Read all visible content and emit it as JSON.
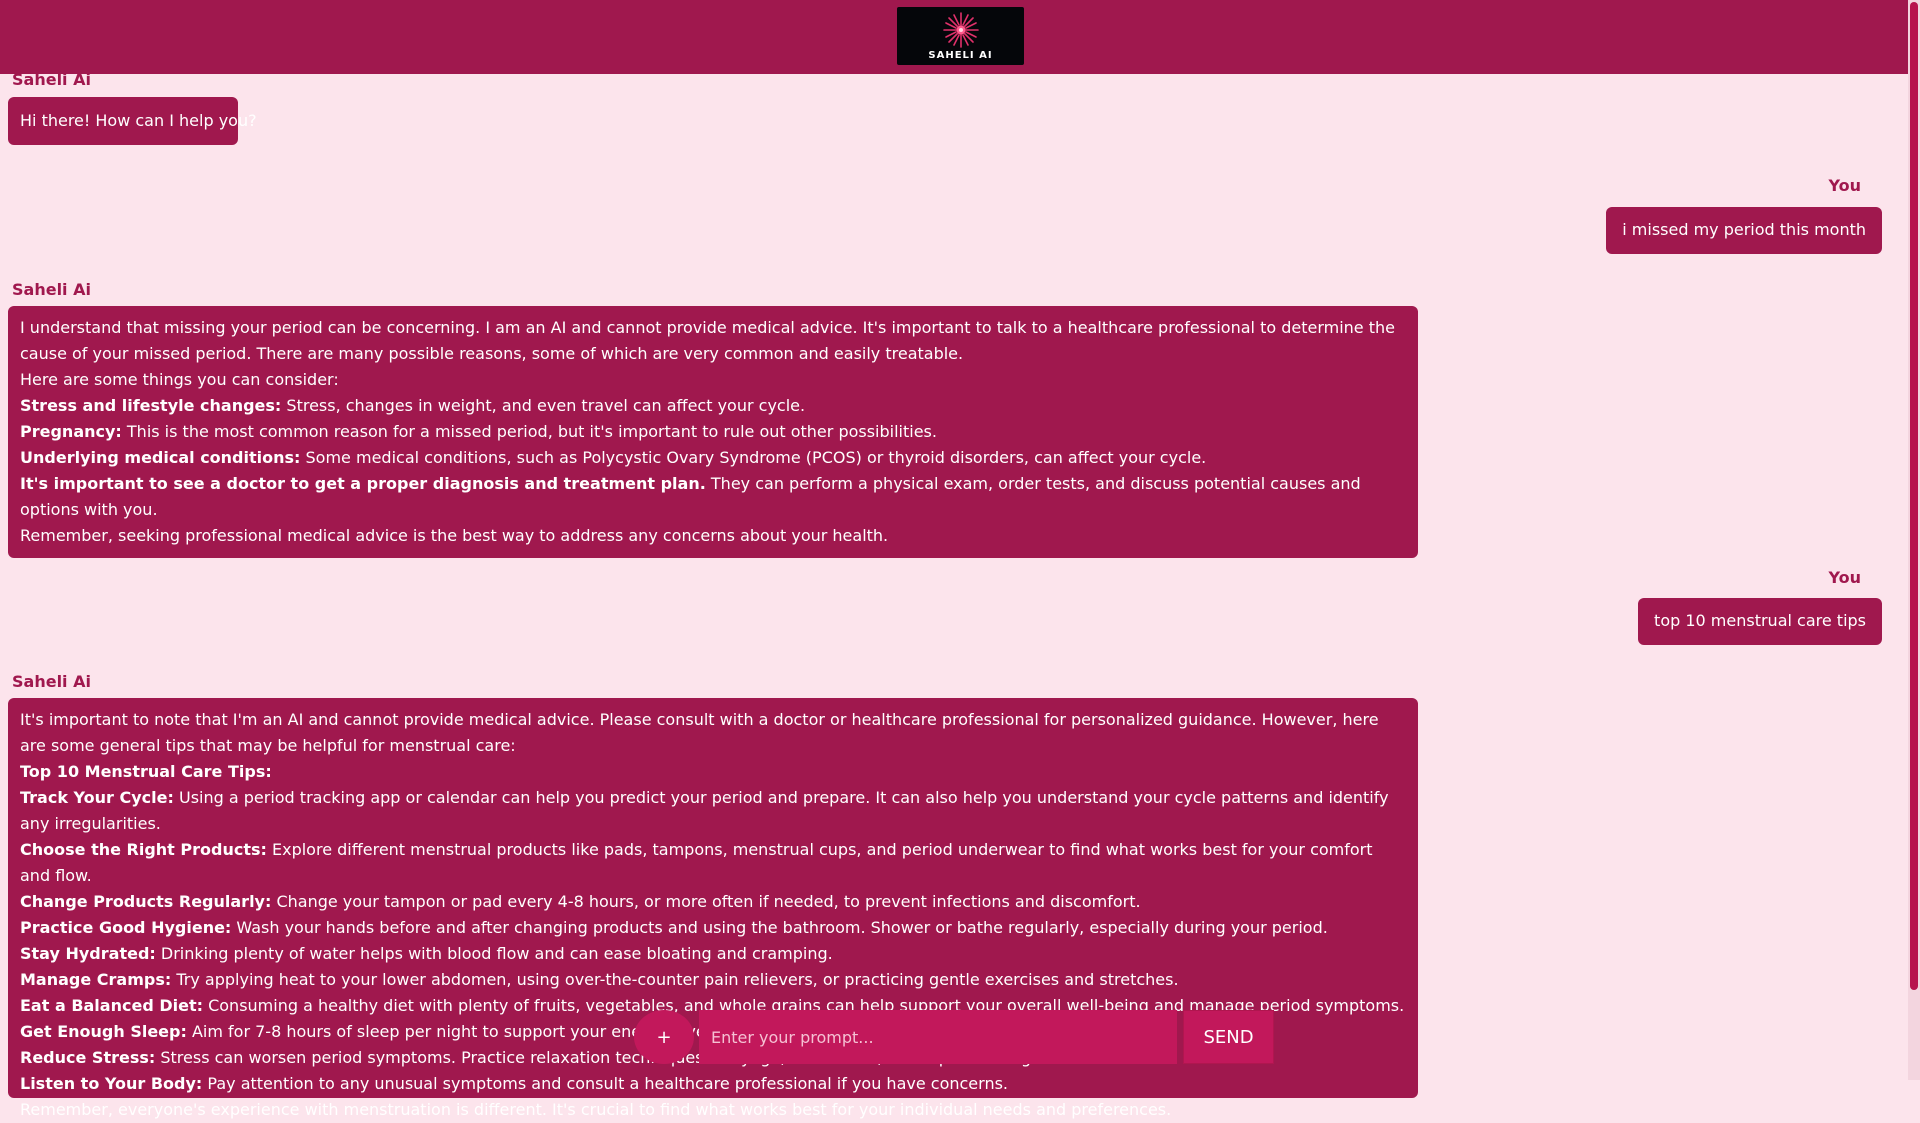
{
  "header": {
    "logo_text": "SAHELI AI"
  },
  "colors": {
    "primary": "#a0184e",
    "accent": "#c2185b",
    "background": "#fce4ec"
  },
  "composer": {
    "plus_label": "+",
    "placeholder": "Enter your prompt...",
    "send_label": "SEND"
  },
  "messages": [
    {
      "sender": "Saheli Ai",
      "lines": [
        "Hi there! How can I help you?"
      ]
    },
    {
      "sender": "You",
      "lines": [
        "i missed my period this month"
      ]
    },
    {
      "sender": "Saheli Ai",
      "lines": [
        {
          "text": "I understand that missing your period can be concerning. I am an AI and cannot provide medical advice. It's important to talk to a healthcare professional to determine the cause of your missed period. There are many possible reasons, some of which are very common and easily treatable."
        },
        {
          "text": "Here are some things you can consider:"
        },
        {
          "bold": "Stress and lifestyle changes:",
          "text": " Stress, changes in weight, and even travel can affect your cycle."
        },
        {
          "bold": "Pregnancy:",
          "text": " This is the most common reason for a missed period, but it's important to rule out other possibilities."
        },
        {
          "bold": "Underlying medical conditions:",
          "text": " Some medical conditions, such as Polycystic Ovary Syndrome (PCOS) or thyroid disorders, can affect your cycle."
        },
        {
          "bold": "It's important to see a doctor to get a proper diagnosis and treatment plan.",
          "text": " They can perform a physical exam, order tests, and discuss potential causes and options with you."
        },
        {
          "text": "Remember, seeking professional medical advice is the best way to address any concerns about your health."
        }
      ]
    },
    {
      "sender": "You",
      "lines": [
        "top 10 menstrual care tips"
      ]
    },
    {
      "sender": "Saheli Ai",
      "lines": [
        {
          "text": "It's important to note that I'm an AI and cannot provide medical advice. Please consult with a doctor or healthcare professional for personalized guidance. However, here are some general tips that may be helpful for menstrual care:"
        },
        {
          "bold": "Top 10 Menstrual Care Tips:",
          "text": ""
        },
        {
          "bold": "Track Your Cycle:",
          "text": " Using a period tracking app or calendar can help you predict your period and prepare. It can also help you understand your cycle patterns and identify any irregularities."
        },
        {
          "bold": "Choose the Right Products:",
          "text": " Explore different menstrual products like pads, tampons, menstrual cups, and period underwear to find what works best for your comfort and flow."
        },
        {
          "bold": "Change Products Regularly:",
          "text": " Change your tampon or pad every 4-8 hours, or more often if needed, to prevent infections and discomfort."
        },
        {
          "bold": "Practice Good Hygiene:",
          "text": " Wash your hands before and after changing products and using the bathroom. Shower or bathe regularly, especially during your period."
        },
        {
          "bold": "Stay Hydrated:",
          "text": " Drinking plenty of water helps with blood flow and can ease bloating and cramping."
        },
        {
          "bold": "Manage Cramps:",
          "text": " Try applying heat to your lower abdomen, using over-the-counter pain relievers, or practicing gentle exercises and stretches."
        },
        {
          "bold": "Eat a Balanced Diet:",
          "text": " Consuming a healthy diet with plenty of fruits, vegetables, and whole grains can help support your overall well-being and manage period symptoms."
        },
        {
          "bold": "Get Enough Sleep:",
          "text": " Aim for 7-8 hours of sleep per night to support your energy levels and hormonal balance."
        },
        {
          "bold": "Reduce Stress:",
          "text": " Stress can worsen period symptoms. Practice relaxation techniques like yoga, meditation, or deep breathing."
        },
        {
          "bold": "Listen to Your Body:",
          "text": " Pay attention to any unusual symptoms and consult a healthcare professional if you have concerns."
        },
        {
          "text": "Remember, everyone's experience with menstruation is different. It's crucial to find what works best for your individual needs and preferences."
        }
      ]
    }
  ]
}
